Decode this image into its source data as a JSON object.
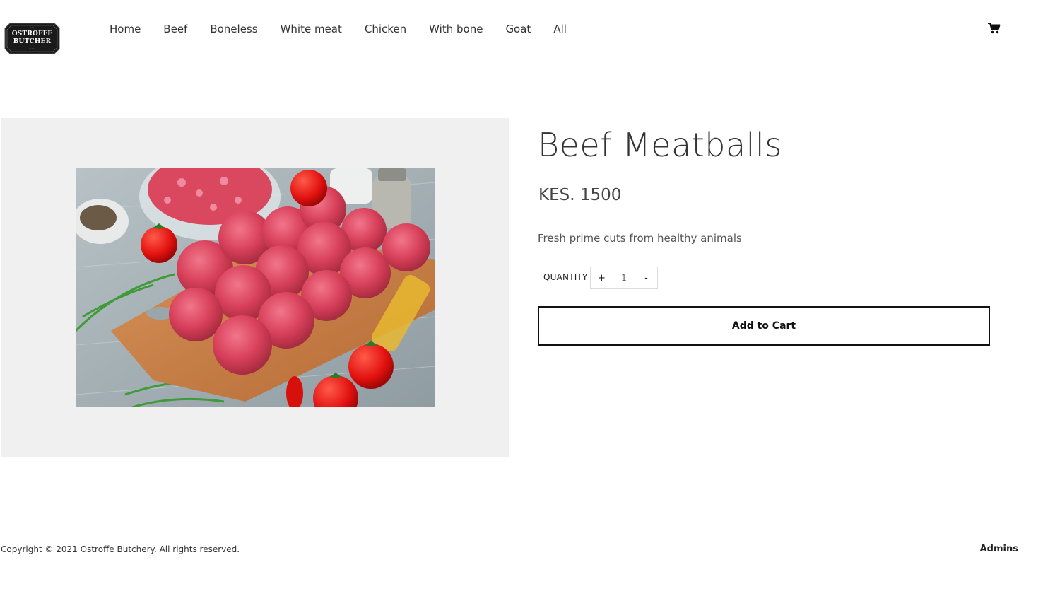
{
  "brand": {
    "logo_line1": "OSTROFFE",
    "logo_line2": "BUTCHER",
    "logo_badge_color": "#1a1a1a"
  },
  "nav": {
    "items": [
      "Home",
      "Beef",
      "Boneless",
      "White meat",
      "Chicken",
      "With bone",
      "Goat",
      "All"
    ]
  },
  "header": {
    "cart_icon": "shopping-cart-icon"
  },
  "product": {
    "title": "Beef Meatballs",
    "price": "KES. 1500",
    "description": "Fresh prime cuts from healthy animals",
    "quantity_label": "QUANTITY",
    "increment_label": "+",
    "decrement_label": "-",
    "quantity_value": "1",
    "add_to_cart_label": "Add to Cart",
    "panel_color": "#f0f0f0"
  },
  "footer": {
    "copyright": "Copyright © 2021 Ostroffe Butchery. All rights reserved.",
    "admins_label": "Admins"
  }
}
